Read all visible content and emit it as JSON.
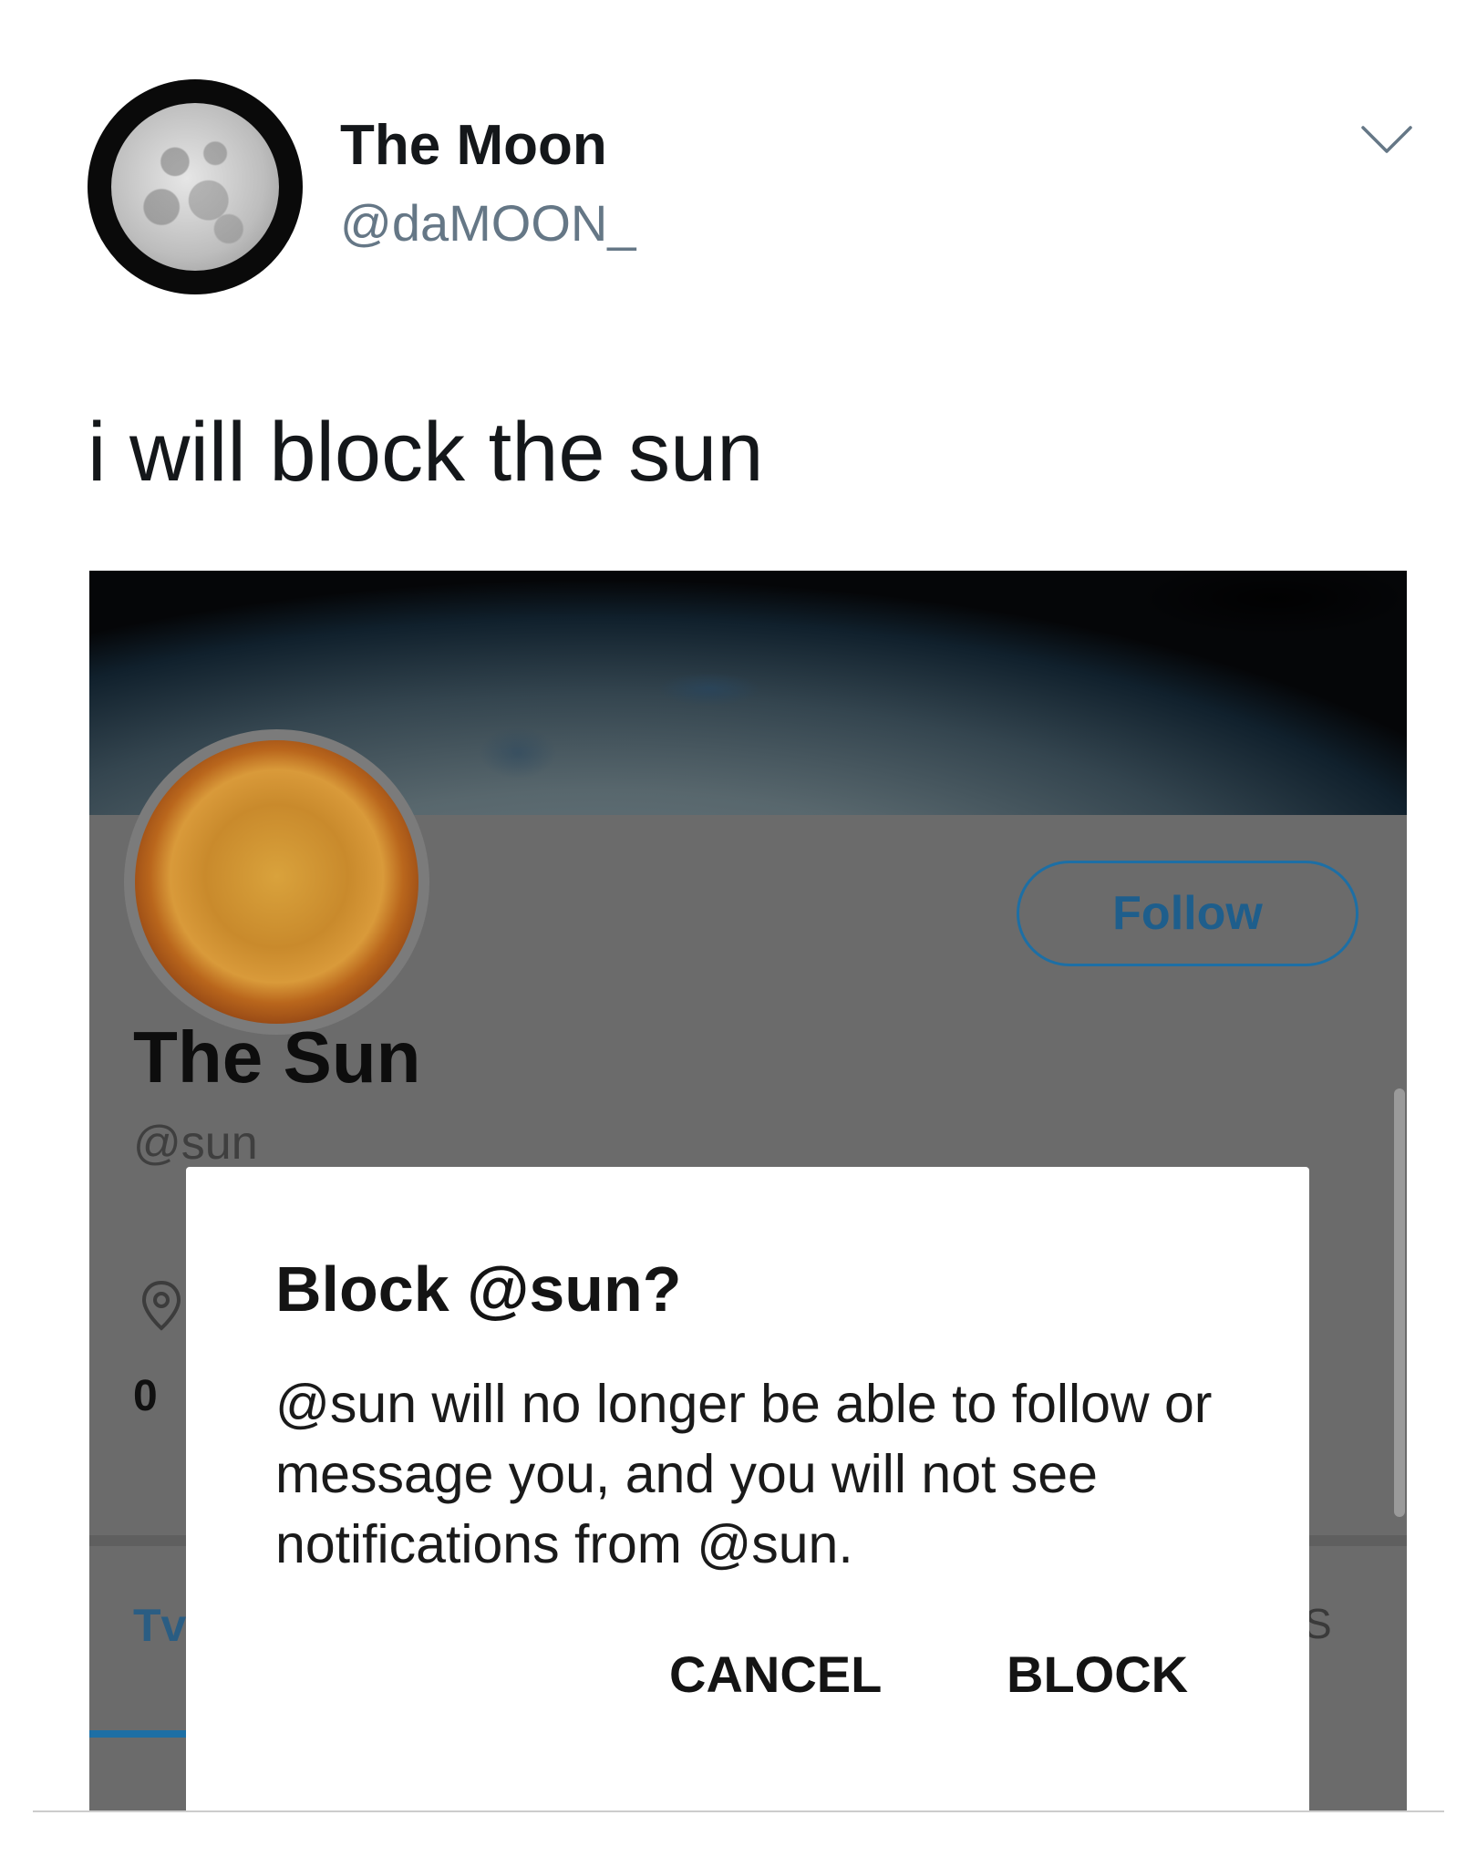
{
  "tweet": {
    "display_name": "The Moon",
    "handle": "@daMOON_",
    "text": "i will block the sun",
    "menu_icon": "chevron-down-icon"
  },
  "profile": {
    "name": "The Sun",
    "handle": "@sun",
    "follow_label": "Follow",
    "count_partial": "0",
    "tab_partial_left": "Tv",
    "tab_partial_right": "S",
    "location_icon": "location-pin-icon",
    "accent_color": "#1d6fa5"
  },
  "dialog": {
    "title": "Block @sun?",
    "message": "@sun will no longer be able to follow or message you, and you will not see notifications from @sun.",
    "cancel_label": "CANCEL",
    "block_label": "BLOCK"
  }
}
